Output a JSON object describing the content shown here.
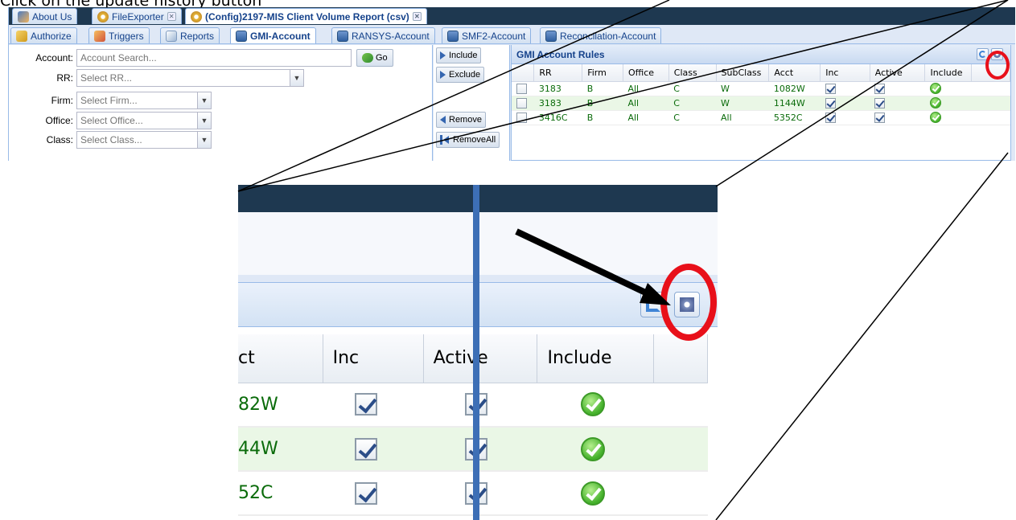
{
  "instruction": "Click on the update history button",
  "doc_tabs": [
    {
      "label": "About Us",
      "closable": false
    },
    {
      "label": "FileExporter",
      "closable": true
    },
    {
      "label": "(Config)2197-MIS Client Volume Report (csv)",
      "closable": true
    }
  ],
  "sub_tabs": [
    {
      "label": "Authorize"
    },
    {
      "label": "Triggers"
    },
    {
      "label": "Reports"
    },
    {
      "label": "GMI-Account"
    },
    {
      "label": "RANSYS-Account"
    },
    {
      "label": "SMF2-Account"
    },
    {
      "label": "Reconcilation-Account"
    }
  ],
  "form": {
    "account_label": "Account:",
    "account_placeholder": "Account Search...",
    "go_label": "Go",
    "rr_label": "RR:",
    "rr_placeholder": "Select RR...",
    "firm_label": "Firm:",
    "firm_placeholder": "Select Firm...",
    "office_label": "Office:",
    "office_placeholder": "Select Office...",
    "class_label": "Class:",
    "class_placeholder": "Select Class..."
  },
  "buttons": {
    "include": "Include",
    "exclude": "Exclude",
    "remove": "Remove",
    "remove_all": "RemoveAll"
  },
  "grid": {
    "title": "GMI Account Rules",
    "columns": [
      "RR",
      "Firm",
      "Office",
      "Class",
      "SubClass",
      "Acct",
      "Inc",
      "Active",
      "Include"
    ],
    "rows": [
      {
        "rr": "3183",
        "firm": "B",
        "office": "All",
        "class": "C",
        "subclass": "W",
        "acct": "1082W",
        "inc": true,
        "active": true,
        "include": true
      },
      {
        "rr": "3183",
        "firm": "B",
        "office": "All",
        "class": "C",
        "subclass": "W",
        "acct": "1144W",
        "inc": true,
        "active": true,
        "include": true
      },
      {
        "rr": "3416C",
        "firm": "B",
        "office": "All",
        "class": "C",
        "subclass": "All",
        "acct": "5352C",
        "inc": true,
        "active": true,
        "include": true
      }
    ]
  },
  "zoom": {
    "columns": [
      "ct",
      "Inc",
      "Active",
      "Include"
    ],
    "acct_fragments": [
      "82W",
      "44W",
      "52C"
    ]
  },
  "colors": {
    "highlight_ring": "#e8101a",
    "arrow": "#000000",
    "row_text": "#0a6b0a"
  }
}
